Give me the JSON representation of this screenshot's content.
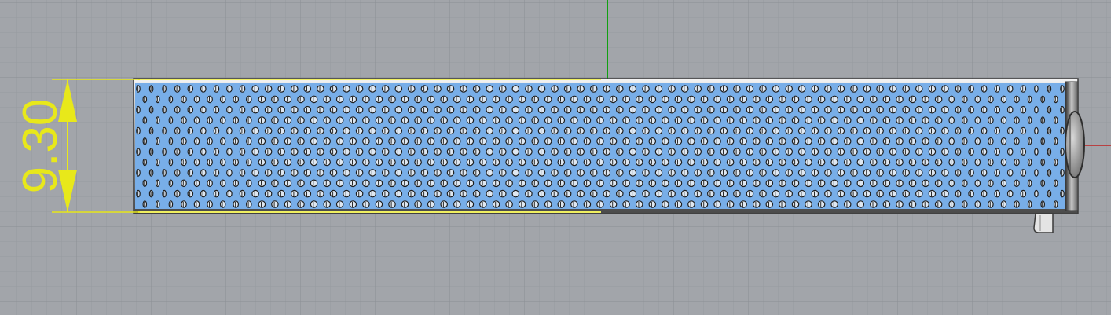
{
  "viewport": {
    "name": "top-viewport",
    "background": "#a2a5aa",
    "grid_minor_color": "#979aa0",
    "grid_major_color": "#8b8e94",
    "axis_x_color": "#c02020",
    "axis_y_color": "#10a010"
  },
  "dimension": {
    "value_text": "9.30",
    "color": "#e8e81a"
  },
  "part": {
    "perforation_color": "#78aee8",
    "hole_rows": 12,
    "hole_columns": 72,
    "frame_color": "#505050"
  }
}
